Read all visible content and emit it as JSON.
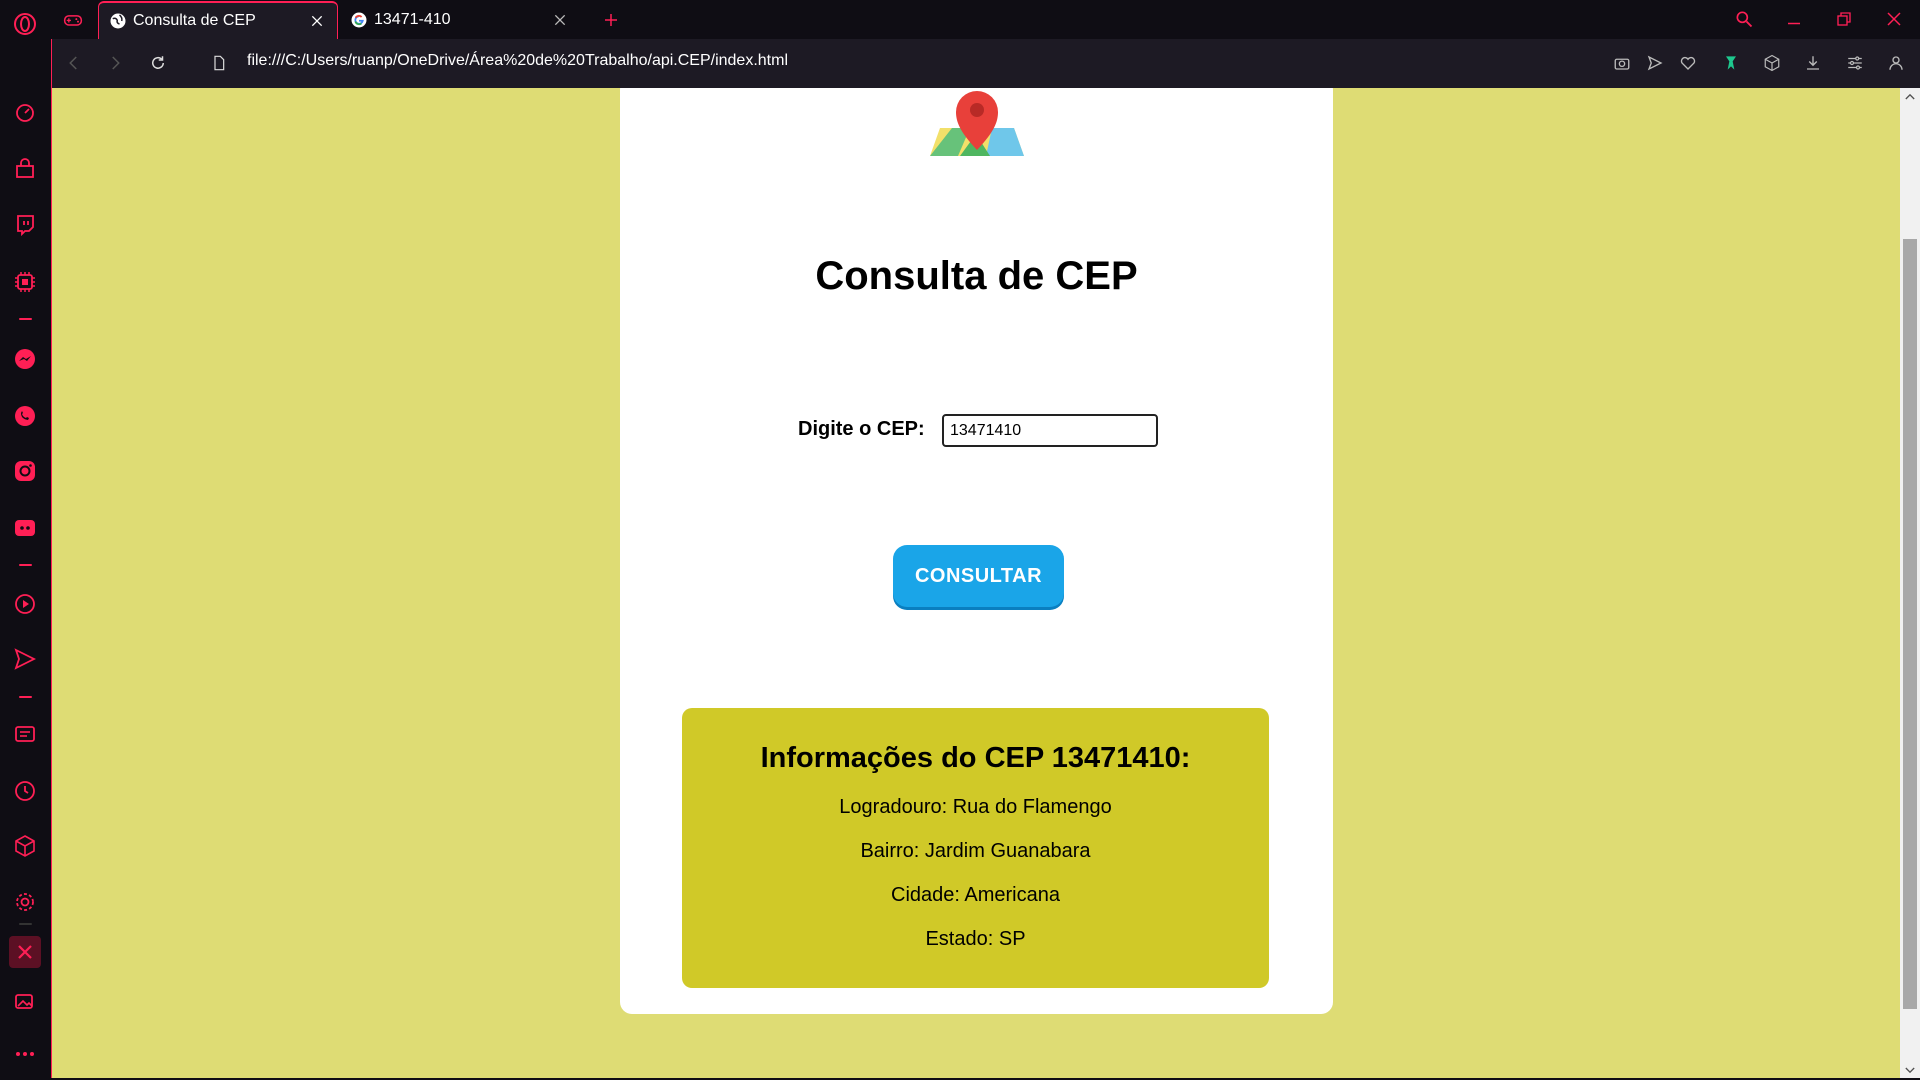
{
  "browser": {
    "tabs": [
      {
        "title": "Consulta de CEP",
        "icon": "globe-icon",
        "active": true
      },
      {
        "title": "13471-410",
        "icon": "google-icon",
        "active": false
      }
    ],
    "url": "file:///C:/Users/ruanp/OneDrive/Área%20de%20Trabalho/api.CEP/index.html",
    "accent_color": "#ff1f55",
    "sidebar_icons": [
      "opera-logo-icon",
      "speed-dial-icon",
      "shopping-icon",
      "twitch-icon",
      "ai-chip-icon",
      "messenger-icon",
      "whatsapp-icon",
      "instagram-icon",
      "discord-icon",
      "player-icon",
      "flow-send-icon",
      "news-icon",
      "history-icon",
      "extensions-cube-icon",
      "settings-gear-icon",
      "tools-icon",
      "gallery-icon",
      "more-dots-icon"
    ]
  },
  "page": {
    "background_color": "#dedc74",
    "title": "Consulta de CEP",
    "cep_label": "Digite o CEP:",
    "cep_value": "13471410",
    "button_label": "CONSULTAR",
    "button_color": "#1aa5e8",
    "info": {
      "box_color": "#d0c928",
      "heading": "Informações do CEP 13471410:",
      "logradouro": "Logradouro: Rua do Flamengo",
      "bairro": "Bairro: Jardim Guanabara",
      "cidade": "Cidade: Americana",
      "estado": "Estado: SP"
    }
  }
}
